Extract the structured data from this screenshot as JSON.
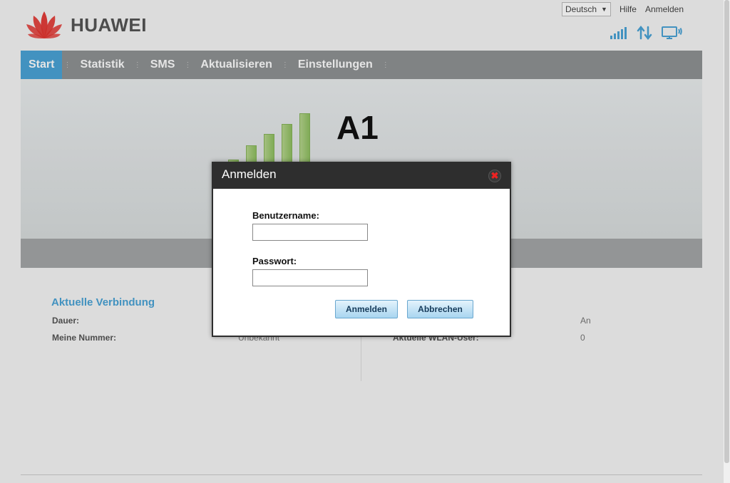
{
  "header": {
    "brand": "HUAWEI",
    "language": "Deutsch",
    "links": {
      "help": "Hilfe",
      "login": "Anmelden"
    },
    "icons": [
      "signal-strength-icon",
      "data-transfer-icon",
      "computer-icon"
    ]
  },
  "nav": {
    "items": [
      {
        "label": "Start",
        "active": true
      },
      {
        "label": "Statistik"
      },
      {
        "label": "SMS"
      },
      {
        "label": "Aktualisieren"
      },
      {
        "label": "Einstellungen"
      }
    ]
  },
  "banner": {
    "operator": "A1",
    "signal_bars_level": 5
  },
  "connection": {
    "title": "Aktuelle Verbindung",
    "rows": [
      {
        "label": "Dauer:",
        "value": ""
      },
      {
        "label": "Meine Nummer:",
        "value": "Unbekannt"
      }
    ],
    "right_rows": [
      {
        "label": "",
        "value": "An"
      },
      {
        "label": "Aktuelle WLAN-User:",
        "value": "0"
      }
    ]
  },
  "dialog": {
    "title": "Anmelden",
    "username_label": "Benutzername:",
    "username_value": "",
    "password_label": "Passwort:",
    "password_value": "",
    "login_button": "Anmelden",
    "cancel_button": "Abbrechen"
  },
  "colors": {
    "accent": "#4aa3d6",
    "nav_bg": "#8f9294",
    "dialog_header": "#2e2e2e",
    "brand_red": "#e3342f",
    "signal_green": "#8fbf61"
  }
}
